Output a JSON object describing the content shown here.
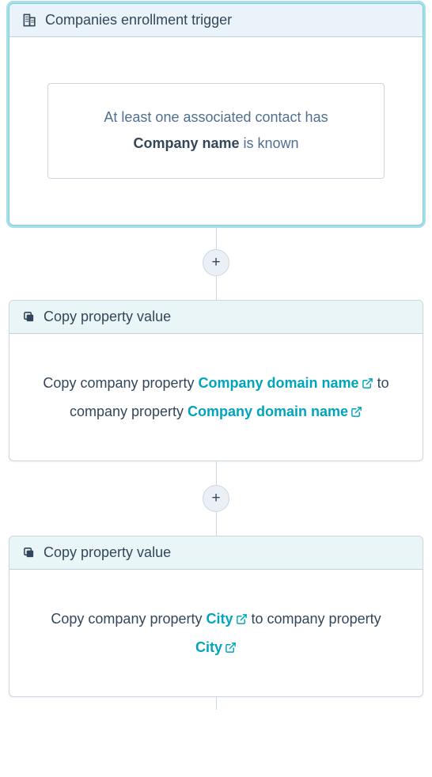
{
  "trigger": {
    "header_label": "Companies enrollment trigger",
    "condition_pre": "At least one associated contact has",
    "condition_prop": "Company name",
    "condition_post": " is known"
  },
  "plus_label": "+",
  "action1": {
    "header_label": "Copy property value",
    "text_pre": "Copy company property ",
    "link1": "Company domain name",
    "text_mid": " to company property ",
    "link2": "Company domain name"
  },
  "action2": {
    "header_label": "Copy property value",
    "text_pre": "Copy company property ",
    "link1": "City",
    "text_mid": " to company property ",
    "link2": "City"
  }
}
